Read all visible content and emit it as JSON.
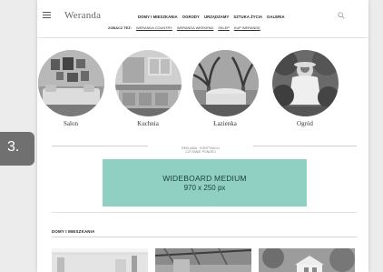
{
  "header": {
    "logo": "Weranda",
    "nav": [
      "DOMY I MIESZKANIA",
      "OGRODY",
      "URZĄDZAMY",
      "SZTUKA ŻYCIA",
      "GALERIA"
    ],
    "see_also_label": "ZOBACZ TEŻ:",
    "see_also_links": [
      "WERANDA COUNTRY",
      "WERANDA WEEKEND",
      "SKLEP",
      "KUP WERANDĘ"
    ]
  },
  "categories": [
    {
      "name": "Salon"
    },
    {
      "name": "Kuchnia"
    },
    {
      "name": "Łazienka"
    },
    {
      "name": "Ogród"
    }
  ],
  "ad": {
    "label_line1": "REKLAMA · KONTYNUUJ",
    "label_line2": "CZYTANIE PONIŻEJ",
    "title": "WIDEBOARD MEDIUM",
    "size": "970 x 250 px"
  },
  "section_title": "DOMY I MIESZKANIA",
  "step_badge": "3."
}
